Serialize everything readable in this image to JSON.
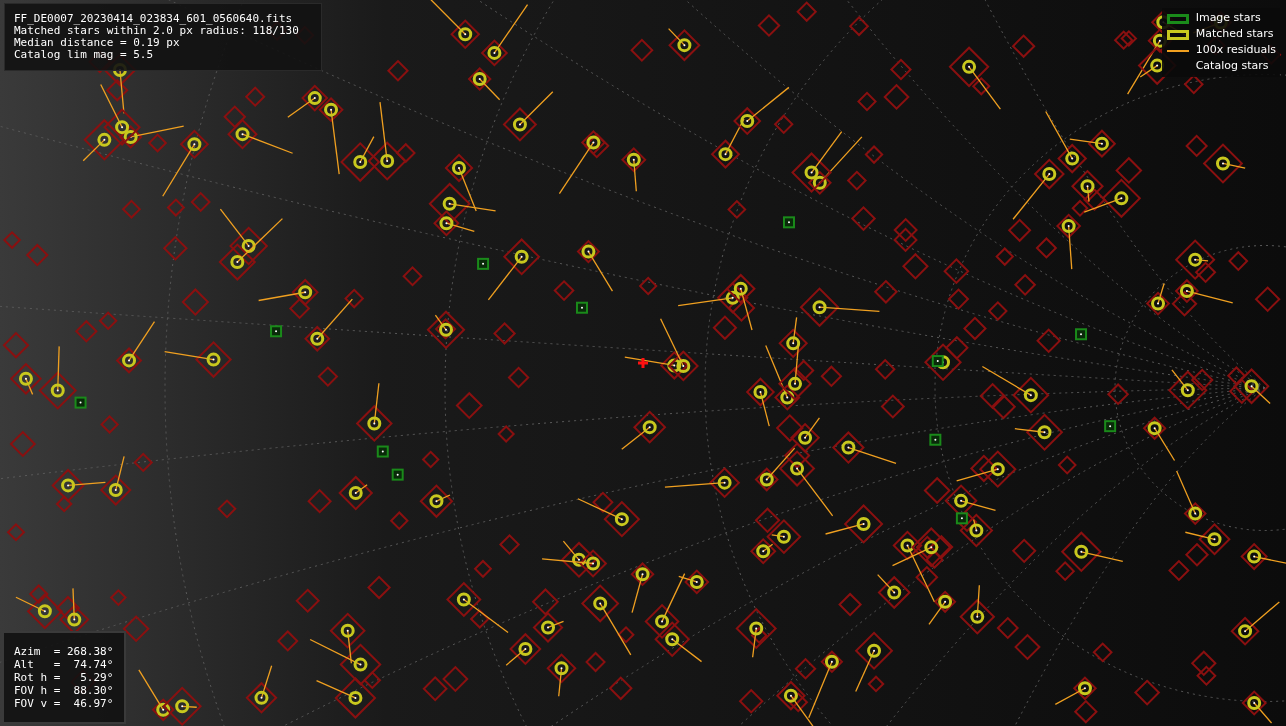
{
  "info_panel": {
    "lines": [
      "FF_DE0007_20230414_023834_601_0560640.fits",
      "Matched stars within 2.0 px radius: 118/130",
      "Median distance = 0.19 px",
      "Catalog lim mag = 5.5"
    ]
  },
  "legend": [
    {
      "label": "Image stars",
      "kind": "box",
      "color": "#1a8a1a"
    },
    {
      "label": "Matched stars",
      "kind": "box",
      "color": "#c8c81e"
    },
    {
      "label": "100x residuals",
      "kind": "line",
      "color": "#f0a020"
    },
    {
      "label": "Catalog stars",
      "kind": "none"
    }
  ],
  "pointing_panel": {
    "lines": [
      "Azim  = 268.38°",
      "Alt   =  74.74°",
      "Rot h =   5.29°",
      "FOV h =  88.30°",
      "FOV v =  46.97°"
    ]
  }
}
